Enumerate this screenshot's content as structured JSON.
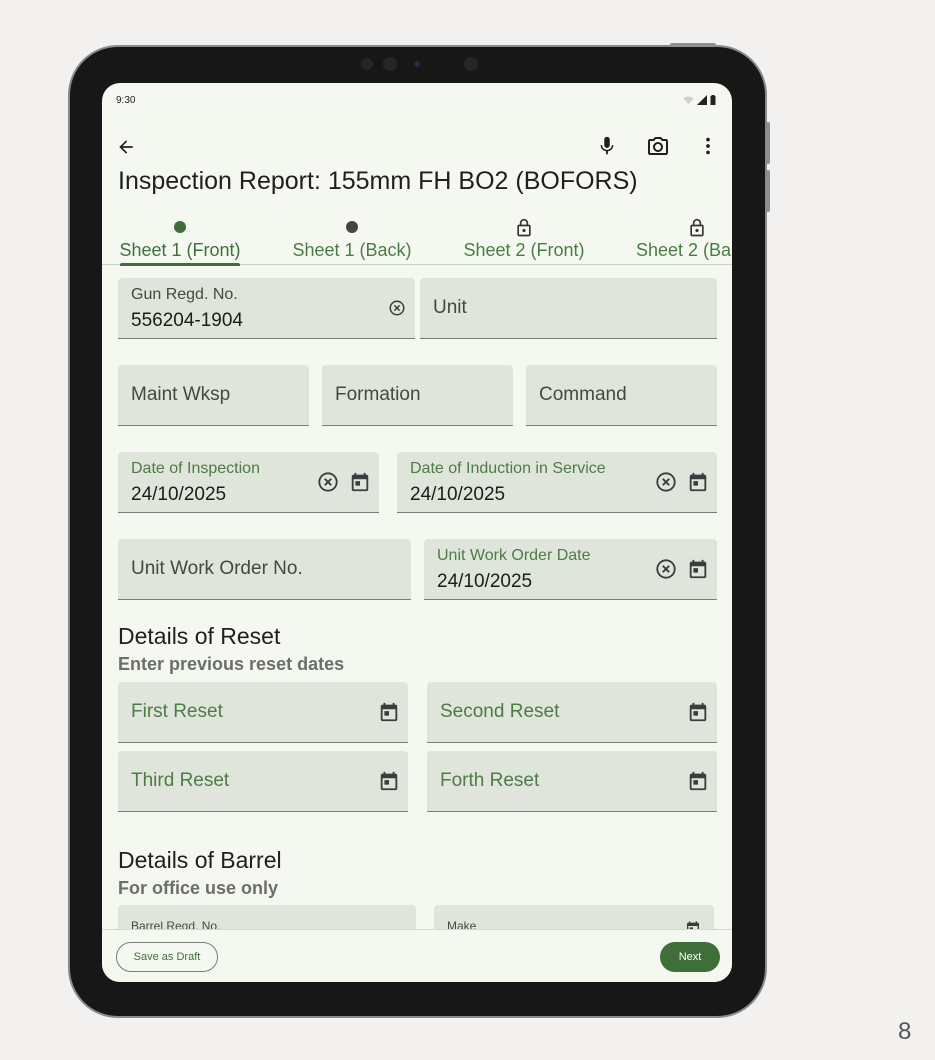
{
  "status_bar": {
    "time": "9:30"
  },
  "app_bar": {
    "title": "Inspection Report: 155mm FH BO2 (BOFORS)",
    "icons": [
      "back-arrow-icon",
      "microphone-icon",
      "camera-icon",
      "more-vert-icon"
    ]
  },
  "tabs": [
    {
      "label": "Sheet 1 (Front)",
      "state": "active"
    },
    {
      "label": "Sheet 1 (Back)",
      "state": "dot"
    },
    {
      "label": "Sheet 2 (Front)",
      "state": "locked"
    },
    {
      "label": "Sheet 2 (Ba",
      "state": "locked"
    }
  ],
  "fields": {
    "gun_regd_no": {
      "label": "Gun Regd. No.",
      "value": "556204-1904"
    },
    "unit": {
      "placeholder": "Unit"
    },
    "maint_wksp": {
      "placeholder": "Maint Wksp"
    },
    "formation": {
      "placeholder": "Formation"
    },
    "command": {
      "placeholder": "Command"
    },
    "date_of_inspection": {
      "label": "Date of Inspection",
      "value": "24/10/2025"
    },
    "date_of_induction": {
      "label": "Date of Induction in Service",
      "value": "24/10/2025"
    },
    "unit_work_order_no": {
      "placeholder": "Unit Work Order No."
    },
    "unit_work_order_date": {
      "label": "Unit Work Order Date",
      "value": "24/10/2025"
    }
  },
  "reset_section": {
    "title": "Details of Reset",
    "subtitle": "Enter previous reset dates",
    "first": "First Reset",
    "second": "Second Reset",
    "third": "Third Reset",
    "fourth": "Forth Reset"
  },
  "barrel_section": {
    "title": "Details of Barrel",
    "subtitle": "For office use only",
    "barrel_regd_no": "Barrel Regd. No.",
    "make": "Make"
  },
  "bottom_bar": {
    "save_draft": "Save as Draft",
    "next": "Next"
  },
  "page_number": "8",
  "colors": {
    "primary": "#3e6f38",
    "field_bg": "#dfe5db",
    "screen_bg": "#f5f8f0",
    "frame": "#171717"
  }
}
